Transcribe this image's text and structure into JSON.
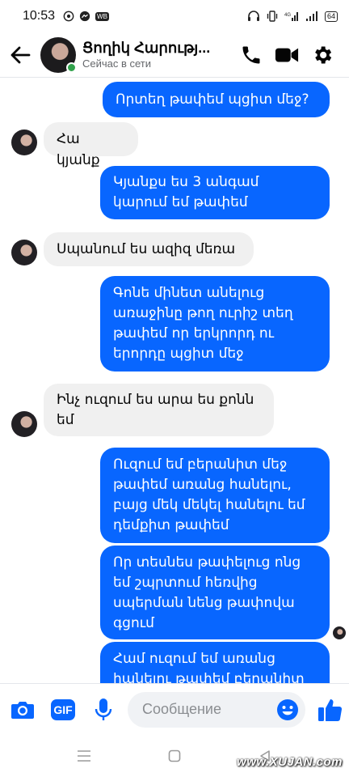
{
  "status_bar": {
    "time": "10:53",
    "battery": "64"
  },
  "header": {
    "contact_name": "Ցողիկ Հարությ...",
    "presence": "Сейчас в сети"
  },
  "messages": [
    {
      "direction": "out",
      "text": "Որտեղ թափեմ պցիտ մեջ?"
    },
    {
      "direction": "in",
      "text": "Հա կյանք"
    },
    {
      "direction": "out",
      "text": "Կյանքս ես 3 անգամ կարում եմ թափեմ"
    },
    {
      "direction": "in",
      "text": "Սպանում ես ազիզ մեռա"
    },
    {
      "direction": "out",
      "text": "Գոնե մինետ անելուց առաջինը թող ուրիշ տեղ թափեմ որ երկրորդ ու երորդը պցիտ մեջ"
    },
    {
      "direction": "in",
      "text": "Ինչ ուզում ես արա ես քոնն եմ"
    },
    {
      "direction": "out",
      "text": "Ուզում եմ բերանիտ մեջ թափեմ առանց հանելու, բայց մեկ մեկել հանելու եմ դեմքիտ թափեմ"
    },
    {
      "direction": "out",
      "text": "Որ տեսնես թափելուց ոնց եմ շպրտում հեռվից սպերման նենց թափովա գցում"
    },
    {
      "direction": "out",
      "text": "Համ ուզում եմ առանց հանելու թափեմ բերանիտ"
    }
  ],
  "composer": {
    "placeholder": "Сообщение",
    "gif_label": "GIF"
  },
  "watermark": "www.XUJAN.com",
  "colors": {
    "accent": "#0866ff",
    "incoming_bubble": "#f0f0f0",
    "online": "#31a24c"
  }
}
